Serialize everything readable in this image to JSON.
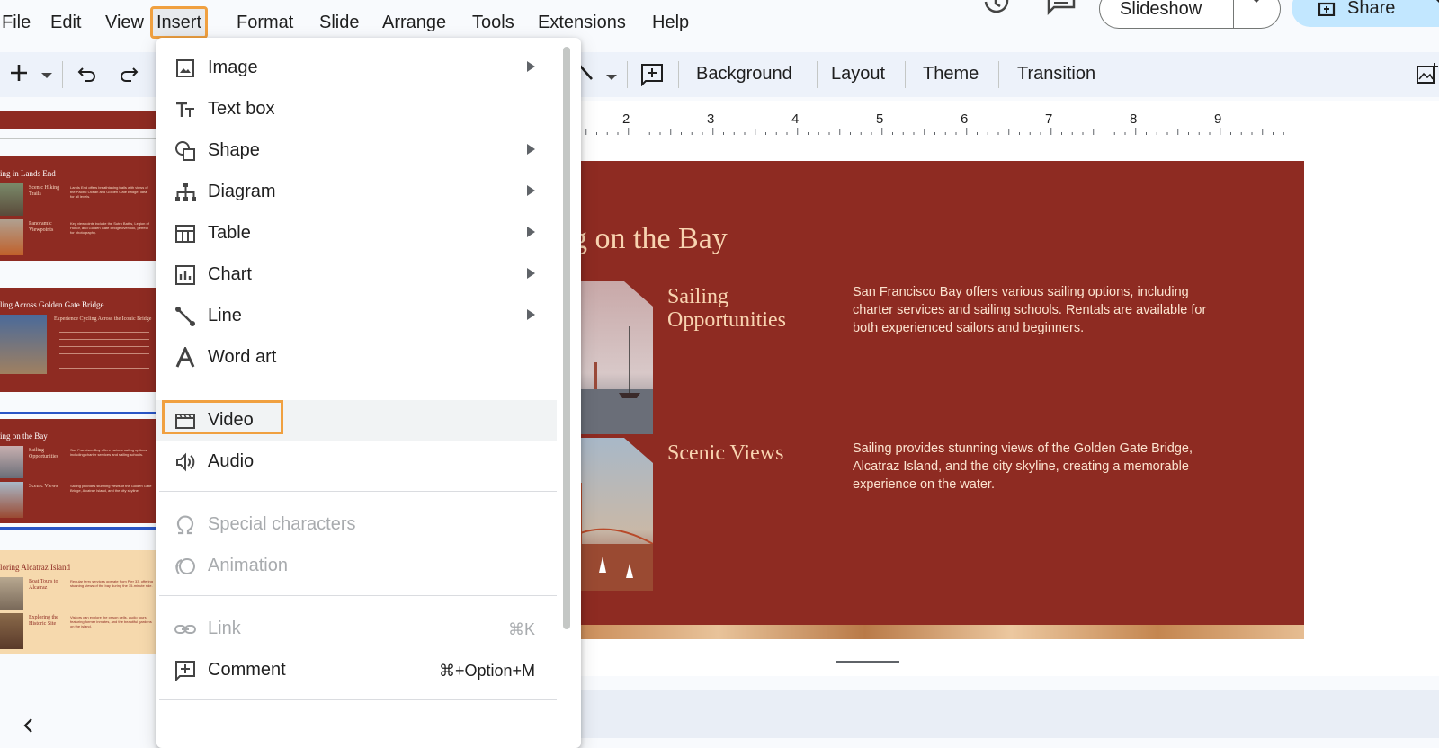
{
  "menubar": {
    "items": [
      "File",
      "Edit",
      "View",
      "Insert",
      "Format",
      "Slide",
      "Arrange",
      "Tools",
      "Extensions",
      "Help"
    ],
    "active": "Insert"
  },
  "header": {
    "slideshow_label": "Slideshow",
    "share_label": "Share"
  },
  "toolbar": {
    "background_label": "Background",
    "layout_label": "Layout",
    "theme_label": "Theme",
    "transition_label": "Transition"
  },
  "ruler": {
    "numbers": [
      "2",
      "3",
      "4",
      "5",
      "6",
      "7",
      "8",
      "9"
    ]
  },
  "filmstrip": {
    "thumb1": {
      "title": "ing in Lands End",
      "sub1": "Scenic Hiking Trails",
      "body1": "Lands End offers breathtaking trails with views of the Pacific Ocean and Golden Gate Bridge, ideal for all levels.",
      "sub2": "Panoramic Viewpoints",
      "body2": "Key viewpoints include the Sutro Baths, Legion of Honor, and Golden Gate Bridge overlook, perfect for photography."
    },
    "thumb2": {
      "title": "ling Across Golden Gate Bridge",
      "sub": "Experience Cycling Across the Iconic Bridge"
    },
    "thumb3": {
      "title": "ing on the Bay",
      "sub1": "Sailing Opportunities",
      "body1": "San Francisco Bay offers various sailing options, including charter services and sailing schools.",
      "sub2": "Scenic Views",
      "body2": "Sailing provides stunning views of the Golden Gate Bridge, Alcatraz Island, and the city skyline."
    },
    "thumb4": {
      "title": "loring Alcatraz Island",
      "sub1": "Boat Tours to Alcatraz",
      "body1": "Regular ferry services operate from Pier 33, offering stunning views of the bay during the 15-minute ride.",
      "sub2": "Exploring the Historic Site",
      "body2": "Visitors can explore the prison cells, audio tours featuring former inmates, and the beautiful gardens on the island."
    }
  },
  "slide": {
    "title": "g on the Bay",
    "section1_title": "Sailing Opportunities",
    "section1_body": "San Francisco Bay offers various sailing options, including charter services and sailing schools. Rentals are available for both experienced sailors and beginners.",
    "section2_title": "Scenic Views",
    "section2_body": "Sailing provides stunning views of the Golden Gate Bridge, Alcatraz Island, and the city skyline, creating a memorable experience on the water."
  },
  "insert_menu": {
    "image": "Image",
    "text_box": "Text box",
    "shape": "Shape",
    "diagram": "Diagram",
    "table": "Table",
    "chart": "Chart",
    "line": "Line",
    "word_art": "Word art",
    "video": "Video",
    "audio": "Audio",
    "special_characters": "Special characters",
    "animation": "Animation",
    "link": "Link",
    "link_shortcut": "⌘K",
    "comment": "Comment",
    "comment_shortcut": "⌘+Option+M"
  }
}
